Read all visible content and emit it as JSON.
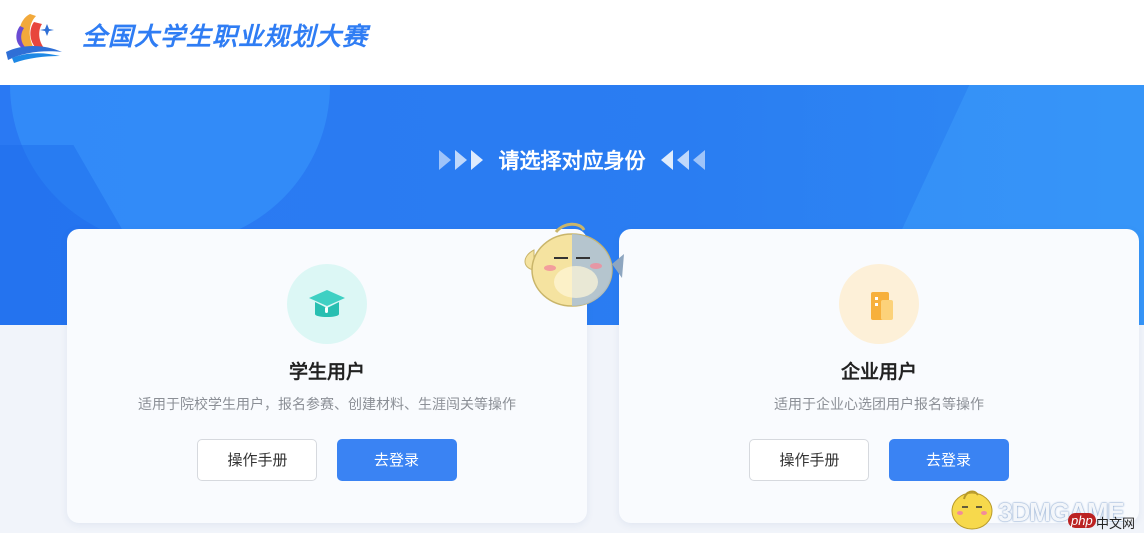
{
  "header": {
    "site_title": "全国大学生职业规划大赛",
    "logo_icon": "sail-logo-icon"
  },
  "hero": {
    "heading": "请选择对应身份"
  },
  "cards": [
    {
      "title": "学生用户",
      "description": "适用于院校学生用户，报名参赛、创建材料、生涯闯关等操作",
      "icon": "graduation-cap-icon",
      "manual_label": "操作手册",
      "login_label": "去登录"
    },
    {
      "title": "企业用户",
      "description": "适用于企业心选团用户报名等操作",
      "icon": "building-icon",
      "manual_label": "操作手册",
      "login_label": "去登录"
    }
  ],
  "watermark": {
    "brand": "3DMGAME",
    "php": "php",
    "cn": "中文网"
  },
  "colors": {
    "primary": "#3a83f3",
    "hero_blue": "#2a79f3",
    "title_blue": "#2f7df4"
  }
}
